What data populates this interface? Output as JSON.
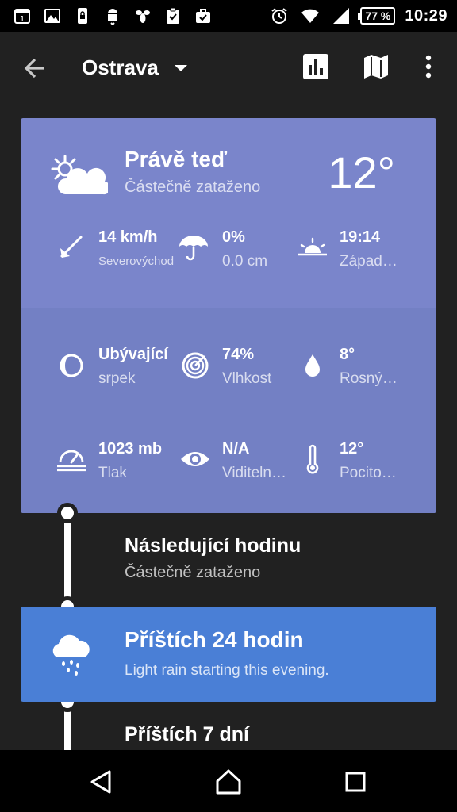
{
  "status_bar": {
    "battery": "77 %",
    "time": "10:29",
    "icons": [
      "calendar-icon",
      "image-icon",
      "phone-lock-icon",
      "android-icon",
      "bee-icon",
      "clipboard-check-icon",
      "briefcase-check-icon",
      "alarm-icon",
      "wifi-icon",
      "signal-icon",
      "battery-icon"
    ]
  },
  "toolbar": {
    "location": "Ostrava",
    "icons": [
      "back-arrow-icon",
      "dropdown-caret-icon",
      "chart-icon",
      "map-icon",
      "more-vert-icon"
    ]
  },
  "now": {
    "title": "Právě teď",
    "condition": "Částečně zataženo",
    "temperature": "12°",
    "icon": "partly-cloudy-icon",
    "stats": {
      "wind": {
        "value": "14 km/h",
        "label": "Severovýchod",
        "icon": "wind-direction-icon"
      },
      "precip": {
        "value": "0%",
        "label": "0.0 cm",
        "icon": "umbrella-icon"
      },
      "sunset": {
        "value": "19:14",
        "label": "Západ…",
        "icon": "sunset-icon"
      },
      "moon": {
        "value": "Ubývající",
        "label": "srpek",
        "icon": "moon-phase-icon"
      },
      "humidity": {
        "value": "74%",
        "label": "Vlhkost",
        "icon": "humidity-icon"
      },
      "dew": {
        "value": "8°",
        "label": "Rosný…",
        "icon": "dew-drop-icon"
      },
      "pressure": {
        "value": "1023 mb",
        "label": "Tlak",
        "icon": "pressure-gauge-icon"
      },
      "visibility": {
        "value": "N/A",
        "label": "Viditeln…",
        "icon": "eye-icon"
      },
      "feels": {
        "value": "12°",
        "label": "Pocito…",
        "icon": "thermometer-icon"
      }
    }
  },
  "next_hour": {
    "title": "Následující hodinu",
    "condition": "Částečně zataženo"
  },
  "next_24": {
    "title": "Příštích 24 hodin",
    "summary": "Light rain starting this evening.",
    "icon": "rain-cloud-icon"
  },
  "next_7": {
    "title": "Příštích 7 dní"
  },
  "nav": {
    "icons": [
      "nav-back-icon",
      "nav-home-icon",
      "nav-recents-icon"
    ]
  },
  "colors": {
    "background": "#212121",
    "now_card": "#7A85CB",
    "now_card_lower": "#7380C4",
    "card_24": "#4A7FD6"
  }
}
